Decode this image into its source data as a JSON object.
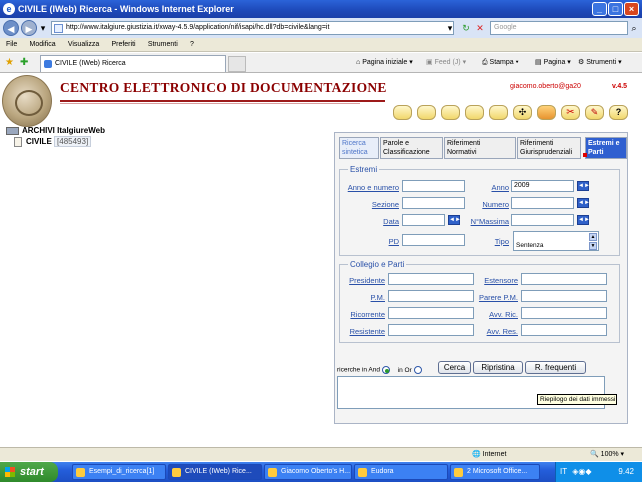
{
  "window": {
    "title": "CIVILE (IWeb) Ricerca - Windows Internet Explorer"
  },
  "browser": {
    "address": "http://www.italgiure.giustizia.it/xway-4.5.9/application/nif/isapi/hc.dll?db=civile&lang=it",
    "search_placeholder": "Google",
    "menu": [
      "File",
      "Modifica",
      "Visualizza",
      "Preferiti",
      "Strumenti",
      "?"
    ],
    "tab_title": "CIVILE (IWeb) Ricerca",
    "tools": {
      "home": "Pagina iniziale",
      "feed": "Feed (J)",
      "print": "Stampa",
      "page": "Pagina",
      "tools": "Strumenti"
    }
  },
  "header": {
    "title": "CENTRO ELETTRONICO DI DOCUMENTAZIONE",
    "user": "giacomo.oberto@ga20",
    "version": "v.4.5"
  },
  "tree": {
    "root": "ARCHIVI ItalgiureWeb",
    "leaf": "CIVILE",
    "count": "485493"
  },
  "form": {
    "tabs": [
      {
        "line1": "Ricerca sintetica",
        "line2": ""
      },
      {
        "line1": "Parole e",
        "line2": "Classificazione"
      },
      {
        "line1": "Riferimenti",
        "line2": "Normativi"
      },
      {
        "line1": "Riferimenti",
        "line2": "Giurisprudenziali"
      },
      {
        "line1": "Estremi e",
        "line2": "Parti"
      }
    ],
    "estremi": {
      "legend": "Estremi",
      "anno_numero": "Anno e numero",
      "anno": "Anno",
      "anno_value": "2009",
      "sezione": "Sezione",
      "numero": "Numero",
      "data": "Data",
      "massima": "N°Massima",
      "pd": "PD",
      "tipo": "Tipo",
      "tipo_value": "Sentenza"
    },
    "collegio": {
      "legend": "Collegio e Parti",
      "presidente": "Presidente",
      "estensore": "Estensore",
      "pm": "P.M.",
      "parere_pm": "Parere P.M.",
      "ricorrente": "Ricorrente",
      "avv_ric": "Avv. Ric.",
      "resistente": "Resistente",
      "avv_res": "Avv. Res."
    },
    "ricerche_and": "ricerche in And",
    "in_or": "in Or",
    "buttons": {
      "cerca": "Cerca",
      "ripristina": "Ripristina",
      "frequenti": "R. frequenti"
    },
    "tooltip": "Riepilogo dei dati immessi"
  },
  "status": {
    "zone": "Internet",
    "zoom": "100%"
  },
  "taskbar": {
    "start": "start",
    "items": [
      "Esempi_di_ricerca[1]",
      "CIVILE (IWeb) Rice...",
      "Giacomo Oberto's H...",
      "Eudora",
      "2 Microsoft Office..."
    ],
    "clock": "9.42",
    "lang": "IT"
  }
}
